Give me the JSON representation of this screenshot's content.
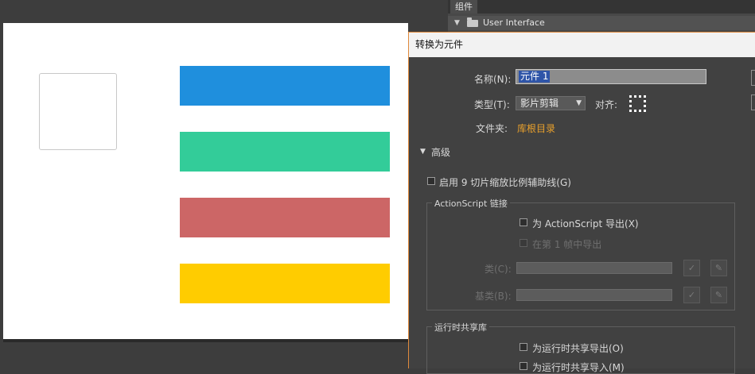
{
  "library": {
    "tab_label": "组件",
    "folder_label": "User Interface"
  },
  "stage": {
    "bar_colors": [
      "#1f8fdd",
      "#33cc99",
      "#cc6666",
      "#ffcc00"
    ]
  },
  "dialog": {
    "title": "转换为元件",
    "name_label": "名称(N):",
    "name_value": "元件 1",
    "type_label": "类型(T):",
    "type_value": "影片剪辑",
    "align_label": "对齐:",
    "folder_label": "文件夹:",
    "folder_value": "库根目录",
    "advanced_label": "高级",
    "enable_9slice_label": "启用 9 切片缩放比例辅助线(G)",
    "as_group_title": "ActionScript 链接",
    "export_as_label": "为 ActionScript 导出(X)",
    "export_frame1_label": "在第 1 帧中导出",
    "class_label": "类(C):",
    "base_class_label": "基类(B):",
    "rsl_group_title": "运行时共享库",
    "rsl_export_label": "为运行时共享导出(O)",
    "rsl_import_label": "为运行时共享导入(M)"
  }
}
